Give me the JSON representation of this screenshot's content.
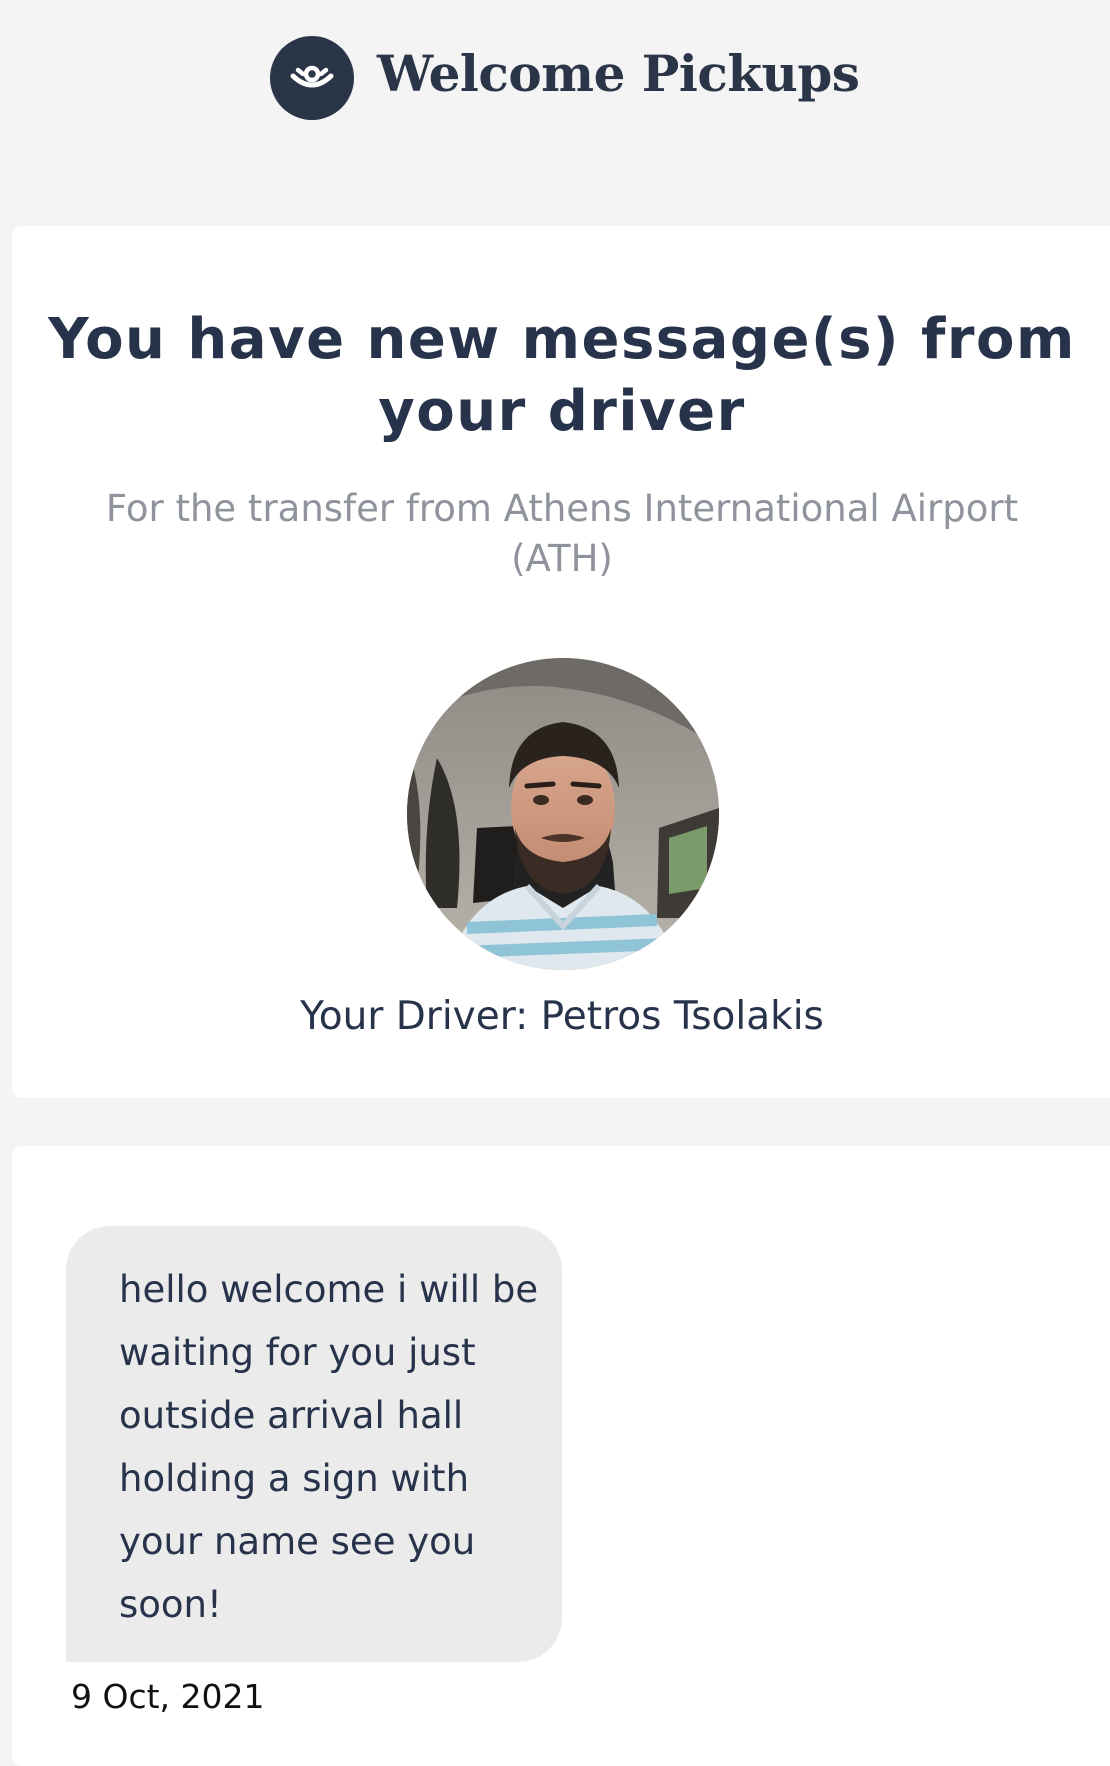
{
  "brand": {
    "name": "Welcome Pickups",
    "logo_icon": "welcome-pickups-logo-icon",
    "color": "#2b3548"
  },
  "notification": {
    "title": "You have new message(s) from your driver",
    "subtitle": "For the transfer from Athens International Airport (ATH)",
    "driver_label": "Your Driver:",
    "driver_name": "Petros Tsolakis",
    "avatar_icon": "driver-photo"
  },
  "messages": [
    {
      "text": "hello welcome i will be waiting for you just outside arrival hall holding a sign with your name see you soon!",
      "date": "9 Oct, 2021"
    }
  ],
  "colors": {
    "background": "#f4f4f4",
    "card": "#ffffff",
    "title": "#27334a",
    "subtitle": "#8f939b",
    "bubble": "#ebebeb"
  }
}
